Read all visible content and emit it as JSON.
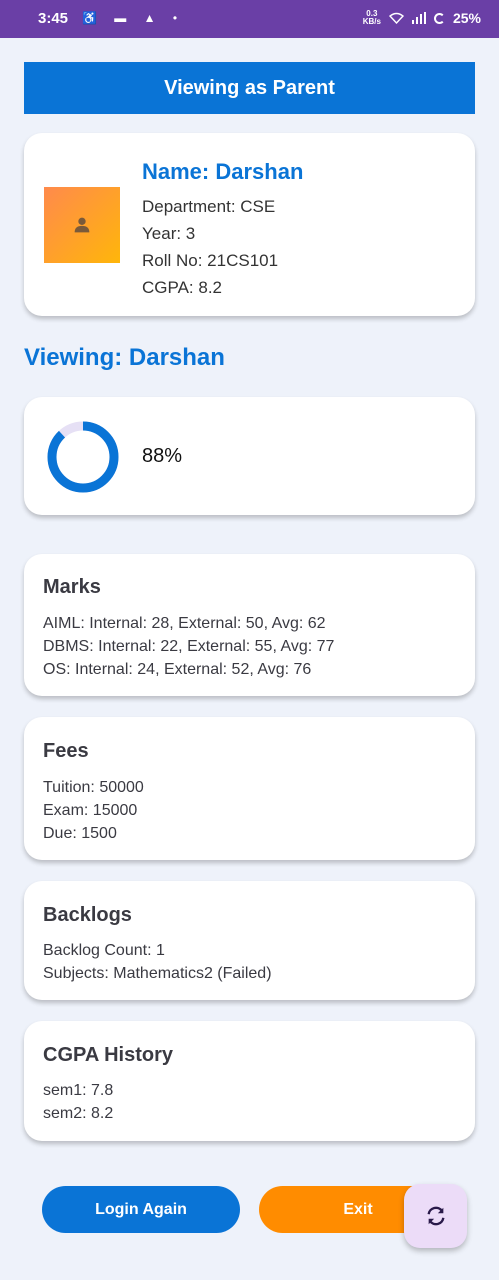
{
  "status_bar": {
    "time": "3:45",
    "speed_value": "0.3",
    "speed_unit": "KB/s",
    "battery": "25%"
  },
  "banner": {
    "title": "Viewing as Parent"
  },
  "profile": {
    "name": "Name: Darshan",
    "department": "Department: CSE",
    "year": "Year: 3",
    "roll_no": "Roll No: 21CS101",
    "cgpa": "CGPA: 8.2"
  },
  "viewing_title": "Viewing: Darshan",
  "attendance": {
    "percent_label": "88%",
    "fraction": 0.88,
    "color": "#0a74d6",
    "track_color": "#e6e0f5"
  },
  "marks": {
    "title": "Marks",
    "lines": [
      "AIML: Internal: 28, External: 50, Avg: 62",
      "DBMS: Internal: 22, External: 55, Avg: 77",
      "OS: Internal: 24, External: 52, Avg: 76"
    ]
  },
  "fees": {
    "title": "Fees",
    "lines": [
      "Tuition: 50000",
      "Exam: 15000",
      "Due: 1500"
    ]
  },
  "backlogs": {
    "title": "Backlogs",
    "lines": [
      "Backlog Count: 1",
      "Subjects: Mathematics2 (Failed)"
    ]
  },
  "cgpa_history": {
    "title": "CGPA History",
    "lines": [
      "sem1: 7.8",
      "sem2: 8.2"
    ]
  },
  "buttons": {
    "login_again": "Login Again",
    "exit": "Exit"
  },
  "fab": {
    "icon": "refresh-icon"
  },
  "colors": {
    "primary": "#0a74d6",
    "accent": "#ff8c00",
    "status_bar": "#6a3fa6"
  }
}
